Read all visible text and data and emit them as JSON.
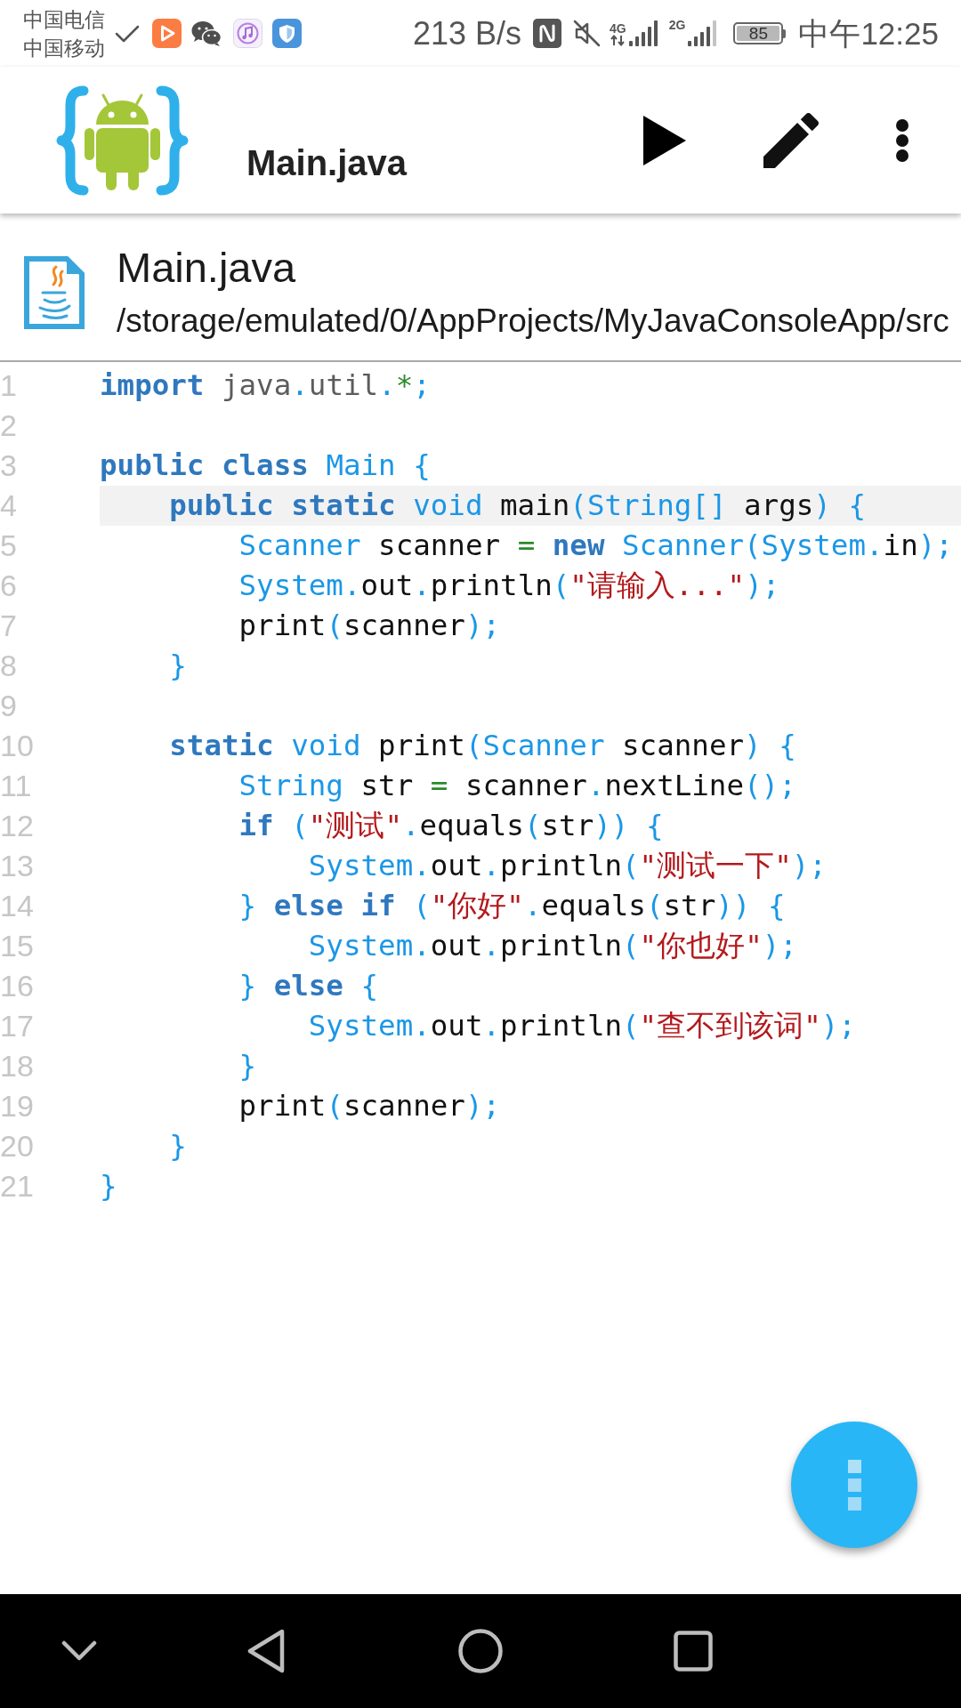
{
  "status_bar": {
    "carriers": [
      "中国电信",
      "中国移动"
    ],
    "network_speed": "213 B/s",
    "signals": [
      {
        "label": "4G",
        "kind": "active"
      },
      {
        "label": "2G",
        "kind": "idle"
      }
    ],
    "battery": "85",
    "time": "中午12:25"
  },
  "toolbar": {
    "title": "Main.java"
  },
  "file": {
    "name": "Main.java",
    "path": "/storage/emulated/0/AppProjects/MyJavaConsoleApp/src"
  },
  "code": {
    "lines": [
      {
        "number": "1",
        "selected": false,
        "tokens": [
          {
            "kind": "keyword",
            "text": "import "
          },
          {
            "kind": "package",
            "text": "java"
          },
          {
            "kind": "punct",
            "text": "."
          },
          {
            "kind": "package",
            "text": "util"
          },
          {
            "kind": "punct",
            "text": "."
          },
          {
            "kind": "operator",
            "text": "*"
          },
          {
            "kind": "punct",
            "text": ";"
          }
        ]
      },
      {
        "number": "2",
        "selected": false
      },
      {
        "number": "3",
        "selected": false,
        "tokens": [
          {
            "kind": "keyword",
            "text": "public "
          },
          {
            "kind": "keyword",
            "text": "class "
          },
          {
            "kind": "type",
            "text": "Main "
          },
          {
            "kind": "punct",
            "text": "{"
          }
        ]
      },
      {
        "number": "4",
        "selected": true,
        "tokens": [
          {
            "kind": "keyword",
            "text": "    public "
          },
          {
            "kind": "keyword",
            "text": "static "
          },
          {
            "kind": "type",
            "text": "void "
          },
          {
            "kind": "name",
            "text": "main"
          },
          {
            "kind": "punct",
            "text": "("
          },
          {
            "kind": "type",
            "text": "String"
          },
          {
            "kind": "punct",
            "text": "[] "
          },
          {
            "kind": "name",
            "text": "args"
          },
          {
            "kind": "punct",
            "text": ") {"
          }
        ]
      },
      {
        "number": "5",
        "selected": false,
        "tokens": [
          {
            "kind": "type",
            "text": "        Scanner "
          },
          {
            "kind": "name",
            "text": "scanner "
          },
          {
            "kind": "operator",
            "text": "= "
          },
          {
            "kind": "keyword",
            "text": "new "
          },
          {
            "kind": "type",
            "text": "Scanner"
          },
          {
            "kind": "punct",
            "text": "("
          },
          {
            "kind": "type",
            "text": "System"
          },
          {
            "kind": "punct",
            "text": "."
          },
          {
            "kind": "name",
            "text": "in"
          },
          {
            "kind": "punct",
            "text": ");"
          }
        ]
      },
      {
        "number": "6",
        "selected": false,
        "tokens": [
          {
            "kind": "type",
            "text": "        System"
          },
          {
            "kind": "punct",
            "text": "."
          },
          {
            "kind": "name",
            "text": "out"
          },
          {
            "kind": "punct",
            "text": "."
          },
          {
            "kind": "name",
            "text": "println"
          },
          {
            "kind": "punct",
            "text": "("
          },
          {
            "kind": "string",
            "text": "\"请输入...\""
          },
          {
            "kind": "punct",
            "text": ");"
          }
        ]
      },
      {
        "number": "7",
        "selected": false,
        "tokens": [
          {
            "kind": "name",
            "text": "        print"
          },
          {
            "kind": "punct",
            "text": "("
          },
          {
            "kind": "name",
            "text": "scanner"
          },
          {
            "kind": "punct",
            "text": ");"
          }
        ]
      },
      {
        "number": "8",
        "selected": false,
        "tokens": [
          {
            "kind": "punct",
            "text": "    }"
          }
        ]
      },
      {
        "number": "9",
        "selected": false
      },
      {
        "number": "10",
        "selected": false,
        "tokens": [
          {
            "kind": "keyword",
            "text": "    static "
          },
          {
            "kind": "type",
            "text": "void "
          },
          {
            "kind": "name",
            "text": "print"
          },
          {
            "kind": "punct",
            "text": "("
          },
          {
            "kind": "type",
            "text": "Scanner "
          },
          {
            "kind": "name",
            "text": "scanner"
          },
          {
            "kind": "punct",
            "text": ") {"
          }
        ]
      },
      {
        "number": "11",
        "selected": false,
        "tokens": [
          {
            "kind": "type",
            "text": "        String "
          },
          {
            "kind": "name",
            "text": "str "
          },
          {
            "kind": "operator",
            "text": "= "
          },
          {
            "kind": "name",
            "text": "scanner"
          },
          {
            "kind": "punct",
            "text": "."
          },
          {
            "kind": "name",
            "text": "nextLine"
          },
          {
            "kind": "punct",
            "text": "();"
          }
        ]
      },
      {
        "number": "12",
        "selected": false,
        "tokens": [
          {
            "kind": "keyword",
            "text": "        if "
          },
          {
            "kind": "punct",
            "text": "("
          },
          {
            "kind": "string",
            "text": "\"测试\""
          },
          {
            "kind": "punct",
            "text": "."
          },
          {
            "kind": "name",
            "text": "equals"
          },
          {
            "kind": "punct",
            "text": "("
          },
          {
            "kind": "name",
            "text": "str"
          },
          {
            "kind": "punct",
            "text": ")) {"
          }
        ]
      },
      {
        "number": "13",
        "selected": false,
        "tokens": [
          {
            "kind": "type",
            "text": "            System"
          },
          {
            "kind": "punct",
            "text": "."
          },
          {
            "kind": "name",
            "text": "out"
          },
          {
            "kind": "punct",
            "text": "."
          },
          {
            "kind": "name",
            "text": "println"
          },
          {
            "kind": "punct",
            "text": "("
          },
          {
            "kind": "string",
            "text": "\"测试一下\""
          },
          {
            "kind": "punct",
            "text": ");"
          }
        ]
      },
      {
        "number": "14",
        "selected": false,
        "tokens": [
          {
            "kind": "punct",
            "text": "        } "
          },
          {
            "kind": "keyword",
            "text": "else "
          },
          {
            "kind": "keyword",
            "text": "if "
          },
          {
            "kind": "punct",
            "text": "("
          },
          {
            "kind": "string",
            "text": "\"你好\""
          },
          {
            "kind": "punct",
            "text": "."
          },
          {
            "kind": "name",
            "text": "equals"
          },
          {
            "kind": "punct",
            "text": "("
          },
          {
            "kind": "name",
            "text": "str"
          },
          {
            "kind": "punct",
            "text": ")) {"
          }
        ]
      },
      {
        "number": "15",
        "selected": false,
        "tokens": [
          {
            "kind": "type",
            "text": "            System"
          },
          {
            "kind": "punct",
            "text": "."
          },
          {
            "kind": "name",
            "text": "out"
          },
          {
            "kind": "punct",
            "text": "."
          },
          {
            "kind": "name",
            "text": "println"
          },
          {
            "kind": "punct",
            "text": "("
          },
          {
            "kind": "string",
            "text": "\"你也好\""
          },
          {
            "kind": "punct",
            "text": ");"
          }
        ]
      },
      {
        "number": "16",
        "selected": false,
        "tokens": [
          {
            "kind": "punct",
            "text": "        } "
          },
          {
            "kind": "keyword",
            "text": "else "
          },
          {
            "kind": "punct",
            "text": "{"
          }
        ]
      },
      {
        "number": "17",
        "selected": false,
        "tokens": [
          {
            "kind": "type",
            "text": "            System"
          },
          {
            "kind": "punct",
            "text": "."
          },
          {
            "kind": "name",
            "text": "out"
          },
          {
            "kind": "punct",
            "text": "."
          },
          {
            "kind": "name",
            "text": "println"
          },
          {
            "kind": "punct",
            "text": "("
          },
          {
            "kind": "string",
            "text": "\"查不到该词\""
          },
          {
            "kind": "punct",
            "text": ");"
          }
        ]
      },
      {
        "number": "18",
        "selected": false,
        "tokens": [
          {
            "kind": "punct",
            "text": "        }"
          }
        ]
      },
      {
        "number": "19",
        "selected": false,
        "tokens": [
          {
            "kind": "name",
            "text": "        print"
          },
          {
            "kind": "punct",
            "text": "("
          },
          {
            "kind": "name",
            "text": "scanner"
          },
          {
            "kind": "punct",
            "text": ");"
          }
        ]
      },
      {
        "number": "20",
        "selected": false,
        "tokens": [
          {
            "kind": "punct",
            "text": "    }"
          }
        ]
      },
      {
        "number": "21",
        "selected": false,
        "tokens": [
          {
            "kind": "punct",
            "text": "}"
          }
        ]
      }
    ]
  }
}
